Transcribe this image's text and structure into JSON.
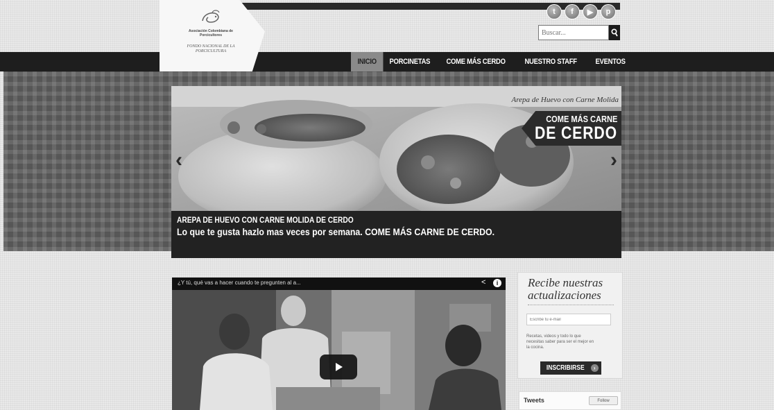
{
  "header": {
    "logo": {
      "org_name": "Asociación Colombiana de Porcicultores",
      "fund_name": "FONDO NACIONAL DE LA PORCICULTURA"
    },
    "social": [
      {
        "name": "twitter",
        "glyph": "t"
      },
      {
        "name": "facebook",
        "glyph": "f"
      },
      {
        "name": "youtube",
        "glyph": "▶"
      },
      {
        "name": "pinterest",
        "glyph": "p"
      }
    ],
    "search": {
      "placeholder": "Buscar..."
    }
  },
  "nav": {
    "items": [
      {
        "label": "INICIO",
        "active": true
      },
      {
        "label": "PORCINETAS"
      },
      {
        "label": "COME MÁS CERDO"
      },
      {
        "label": "NUESTRO STAFF"
      },
      {
        "label": "EVENTOS"
      }
    ]
  },
  "slider": {
    "overlay_title": "Arepa de Huevo con Carne Molida",
    "banner_line1": "COME MÁS CARNE",
    "banner_line2": "DE CERDO",
    "caption_title": "AREPA DE HUEVO CON CARNE MOLIDA DE CERDO",
    "caption_text": "Lo que te gusta hazlo mas veces por semana. COME MÁS CARNE DE CERDO.",
    "prev_glyph": "‹",
    "next_glyph": "›"
  },
  "video": {
    "title": "¿Y tú, qué vas a hacer cuando te pregunten al a...",
    "share_glyph": "<",
    "info_glyph": "i"
  },
  "newsletter": {
    "title": "Recibe nuestras actualizaciones",
    "email_placeholder": "Escribe tu e-mail",
    "description": "Recetas, videos y todo lo que necesitas saber para ser el mejor en la cocina.",
    "subscribe_label": "INSCRIBIRSE",
    "subscribe_icon": "›"
  },
  "tweets": {
    "label": "Tweets",
    "follow_label": "Follow"
  },
  "colors": {
    "nav_bg": "#1e1e1e",
    "nav_active": "#8a8a8a",
    "hero_bg": "#5a5a5a",
    "page_bg": "#e9e9e9"
  }
}
